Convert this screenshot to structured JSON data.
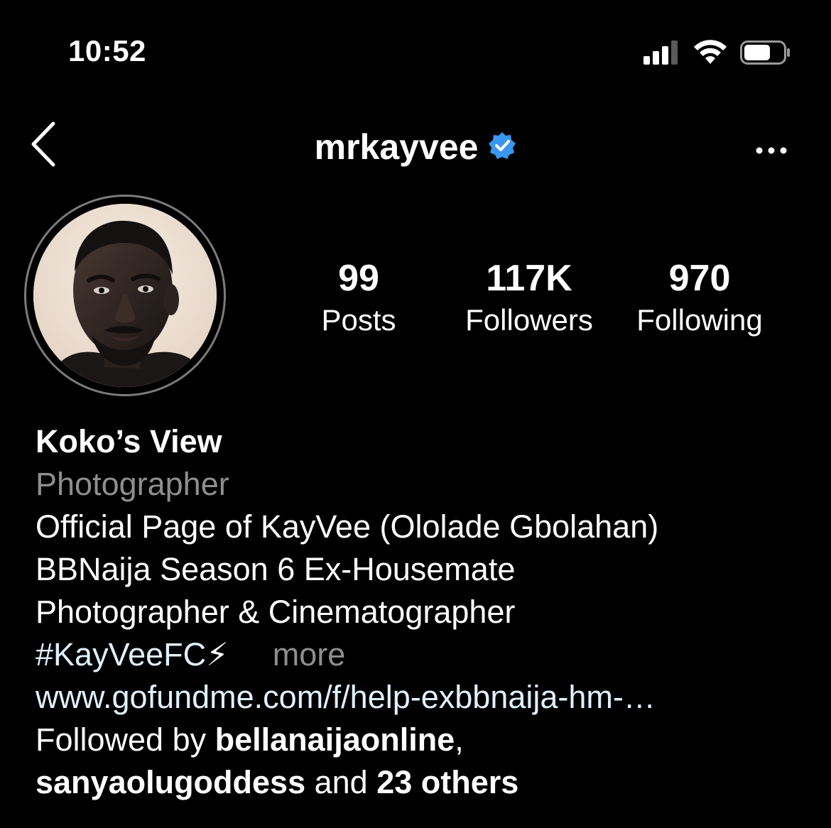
{
  "status_bar": {
    "time": "10:52"
  },
  "header": {
    "username": "mrkayvee",
    "verified_color": "#3897f0"
  },
  "stats": {
    "posts": {
      "value": "99",
      "label": "Posts"
    },
    "followers": {
      "value": "117K",
      "label": "Followers"
    },
    "following": {
      "value": "970",
      "label": "Following"
    }
  },
  "bio": {
    "display_name": "Koko’s View",
    "category": "Photographer",
    "lines": [
      "Official Page of KayVee (Ololade Gbolahan)",
      "BBNaija Season 6 Ex-Housemate",
      "Photographer & Cinematographer"
    ],
    "hashtag": "#KayVeeFC",
    "emoji": "⚡",
    "more_label": "more",
    "link": "www.gofundme.com/f/help-exbbnaija-hm-…"
  },
  "followed_by": {
    "prefix": "Followed by ",
    "user1": "bellanaijaonline",
    "sep": ",",
    "user2": "sanyaolugoddess",
    "and": " and ",
    "others": "23 others"
  },
  "icons": {
    "back": "chevron-left-icon",
    "verified": "verified-badge-icon",
    "more": "ellipsis-icon",
    "signal": "cellular-signal-icon",
    "wifi": "wifi-icon",
    "battery": "battery-icon"
  }
}
